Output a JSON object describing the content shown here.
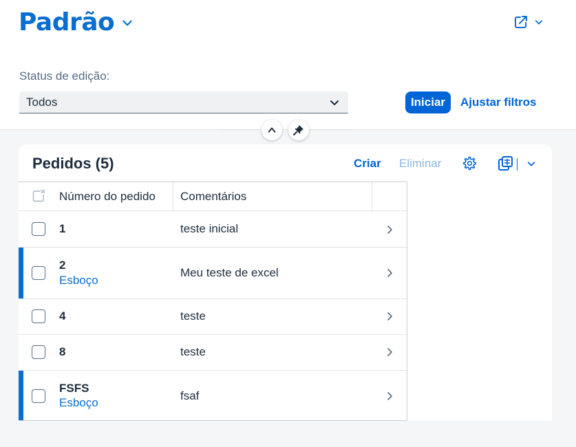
{
  "header": {
    "title": "Padrão",
    "filter": {
      "label": "Status de edição:",
      "selected": "Todos"
    },
    "go_button": "Iniciar",
    "adapt_filters": "Ajustar filtros"
  },
  "table": {
    "title": "Pedidos (5)",
    "toolbar": {
      "create": "Criar",
      "delete": "Eliminar"
    },
    "columns": [
      "Número do pedido",
      "Comentários"
    ],
    "rows": [
      {
        "number": "1",
        "status": "",
        "comment": "teste inicial"
      },
      {
        "number": "2",
        "status": "Esboço",
        "comment": "Meu teste de excel"
      },
      {
        "number": "4",
        "status": "",
        "comment": "teste"
      },
      {
        "number": "8",
        "status": "",
        "comment": "teste"
      },
      {
        "number": "FSFS",
        "status": "Esboço",
        "comment": "fsaf"
      }
    ]
  },
  "colors": {
    "brand": "#0a6ed1",
    "primary_button": "#0064d9",
    "draft_indicator": "#0a6ed1",
    "disabled_link": "#8ab8e6"
  },
  "icons": [
    "chevron-down-icon",
    "share-icon",
    "collapse-up-icon",
    "pin-icon",
    "gear-icon",
    "export-icon",
    "clear-selection-icon",
    "navigation-arrow-icon"
  ]
}
